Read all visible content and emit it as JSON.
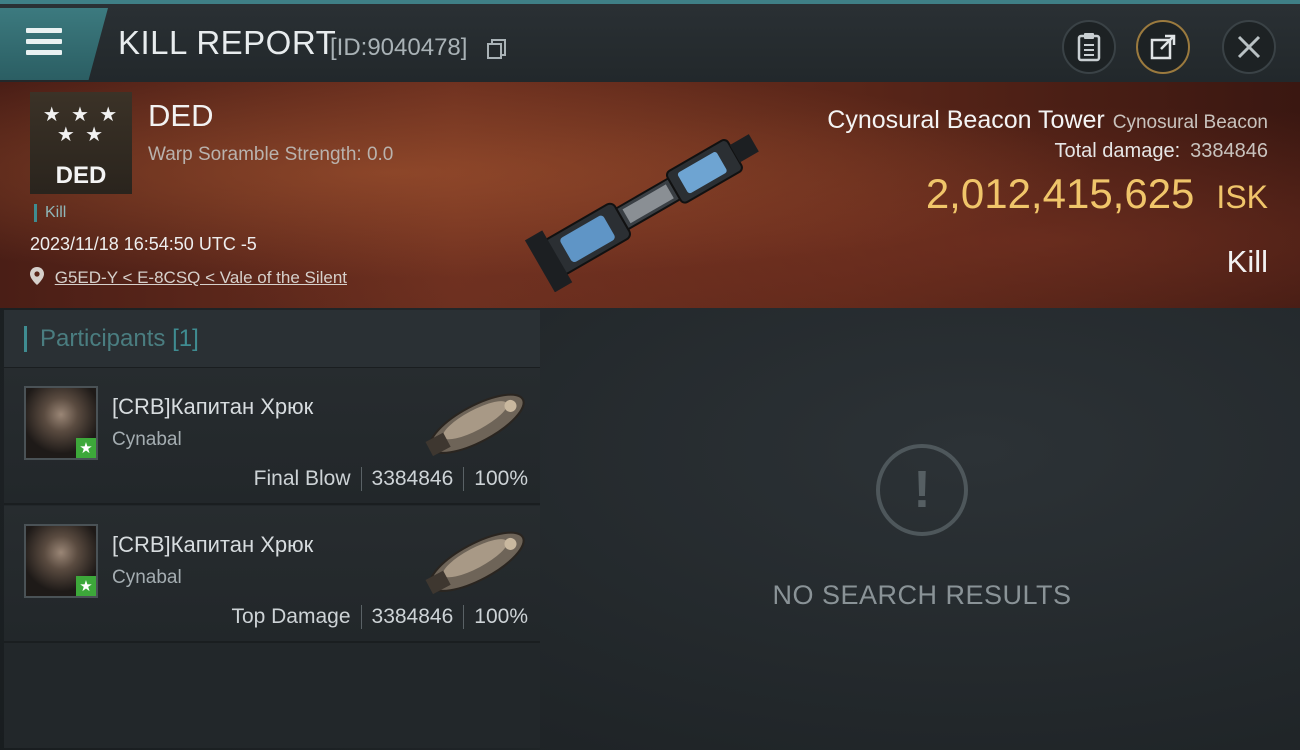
{
  "header": {
    "title": "KILL REPORT",
    "kill_id": "[ID:9040478]",
    "icons": [
      "menu-icon",
      "copy-icon",
      "clipboard-icon",
      "share-icon",
      "close-icon"
    ]
  },
  "banner": {
    "logo_text": "DED",
    "logo_stars": "★ ★ ★\n★ ★",
    "faction": "DED",
    "warp_scramble": "Warp Soramble Strength: 0.0",
    "tag": "Kill",
    "timestamp": "2023/11/18 16:54:50 UTC -5",
    "location": "G5ED-Y < E-8CSQ < Vale of the Silent",
    "victim_ship_name": "Cynosural Beacon Tower",
    "victim_ship_class": "Cynosural Beacon",
    "total_damage_label": "Total damage:",
    "total_damage_value": "3384846",
    "isk_value": "2,012,415,625",
    "isk_unit": "ISK",
    "result": "Kill"
  },
  "participants": {
    "header_label": "Participants",
    "count": "[1]",
    "rows": [
      {
        "name": "[CRB]Капитан Хрюк",
        "ship": "Cynabal",
        "role": "Final Blow",
        "damage": "3384846",
        "percent": "100%"
      },
      {
        "name": "[CRB]Капитан Хрюк",
        "ship": "Cynabal",
        "role": "Top Damage",
        "damage": "3384846",
        "percent": "100%"
      }
    ]
  },
  "results_panel": {
    "empty_text": "NO SEARCH RESULTS"
  },
  "colors": {
    "accent_teal": "#3f8c91",
    "isk_gold": "#f0c56a",
    "banner_red": "#6b2f1f",
    "badge_green": "#3da83a"
  }
}
